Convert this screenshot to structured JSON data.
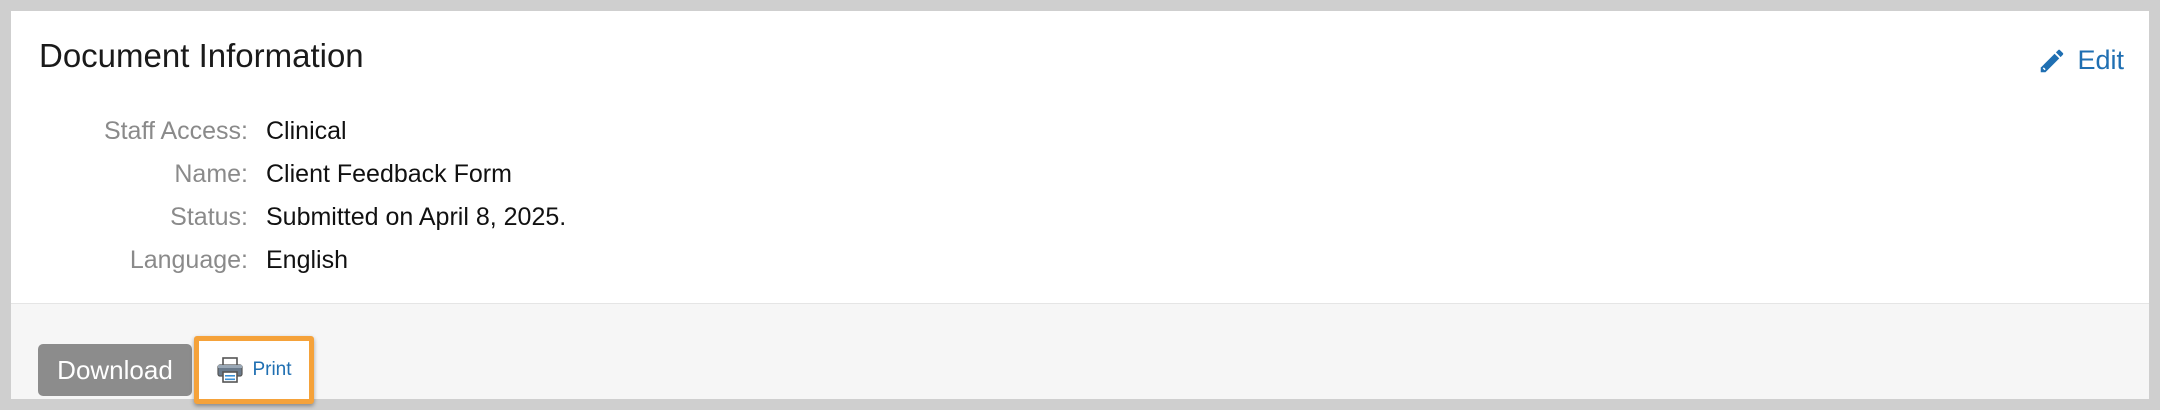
{
  "panel": {
    "title": "Document Information",
    "edit_label": "Edit"
  },
  "info_rows": [
    {
      "label": "Staff Access:",
      "value": "Clinical"
    },
    {
      "label": "Name:",
      "value": "Client Feedback Form"
    },
    {
      "label": "Status:",
      "value": "Submitted on April 8, 2025."
    },
    {
      "label": "Language:",
      "value": "English"
    }
  ],
  "actions": {
    "download_label": "Download",
    "print_label": "Print"
  },
  "icons": {
    "edit": "pencil-icon",
    "print": "printer-icon"
  },
  "colors": {
    "link": "#1f6fb2",
    "download_button": "#8c8c8c",
    "highlight": "#f5a23a"
  }
}
